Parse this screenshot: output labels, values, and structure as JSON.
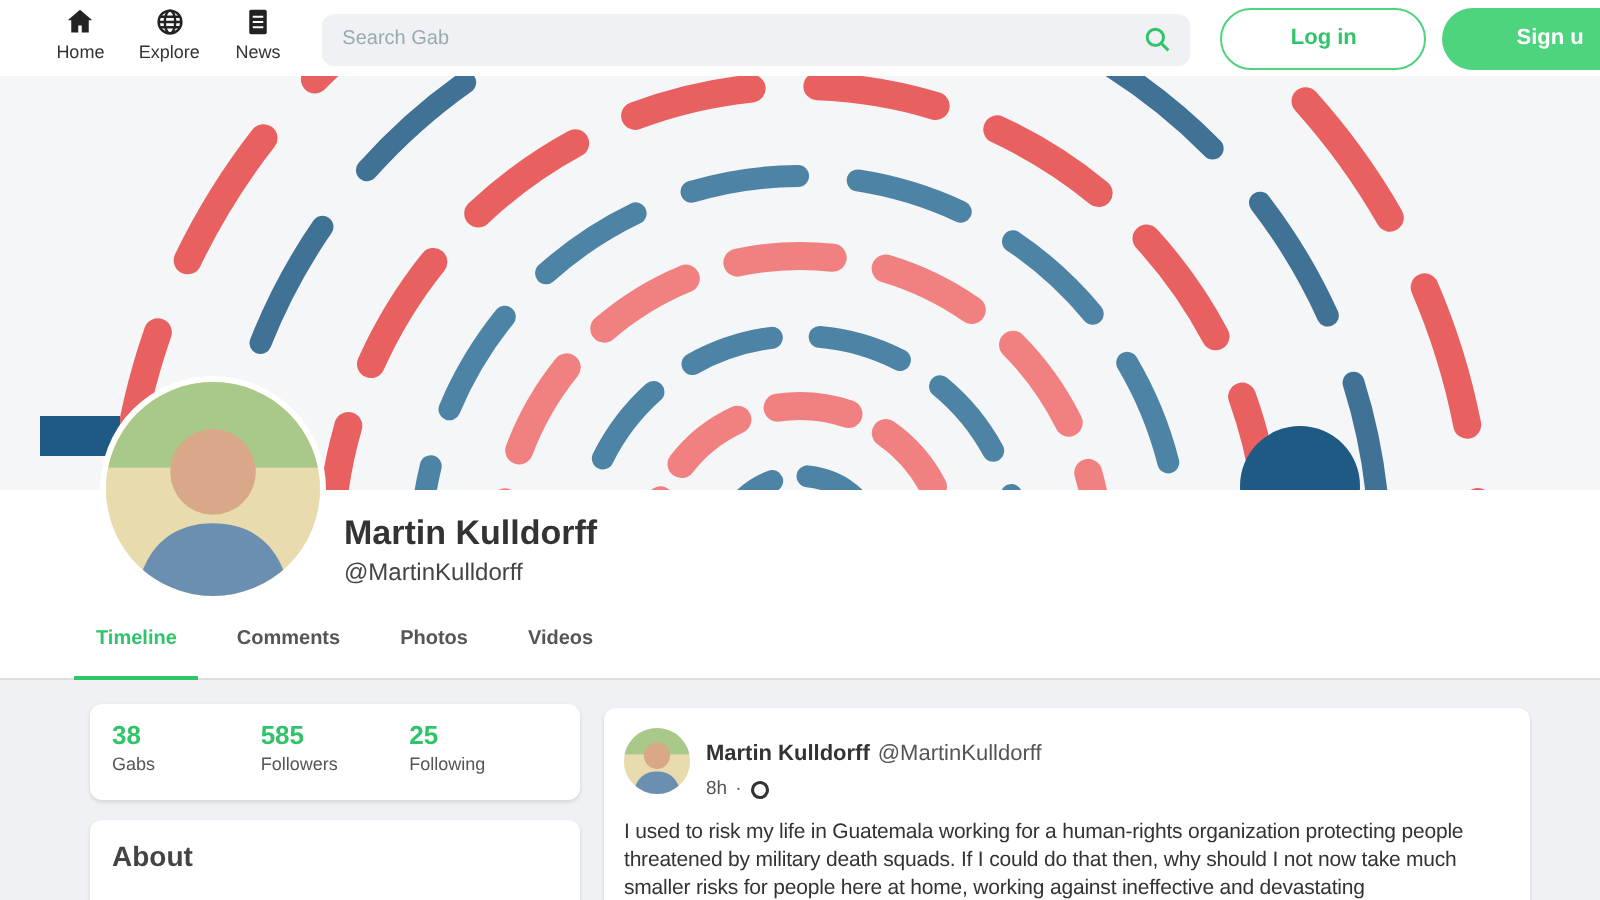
{
  "nav": {
    "items": [
      {
        "label": "Home",
        "kind": "home"
      },
      {
        "label": "Explore",
        "kind": "globe"
      },
      {
        "label": "News",
        "kind": "news"
      }
    ]
  },
  "search": {
    "placeholder": "Search Gab"
  },
  "buttons": {
    "login": "Log in",
    "signup": "Sign u"
  },
  "profile": {
    "name": "Martin Kulldorff",
    "handle": "@MartinKulldorff"
  },
  "tabs": [
    {
      "label": "Timeline",
      "selected": true
    },
    {
      "label": "Comments",
      "selected": false
    },
    {
      "label": "Photos",
      "selected": false
    },
    {
      "label": "Videos",
      "selected": false
    }
  ],
  "stats": [
    {
      "value": "38",
      "label": "Gabs"
    },
    {
      "value": "585",
      "label": "Followers"
    },
    {
      "value": "25",
      "label": "Following"
    }
  ],
  "about": {
    "title": "About"
  },
  "post": {
    "author": "Martin Kulldorff",
    "handle": "@MartinKulldorff",
    "time": "8h",
    "separator": "·",
    "text": "I used to risk my life in Guatemala working for a human-rights organization protecting people threatened by military death squads. If I could do that then, why should I not now take much smaller risks for people here at home, working against ineffective and devastating"
  }
}
